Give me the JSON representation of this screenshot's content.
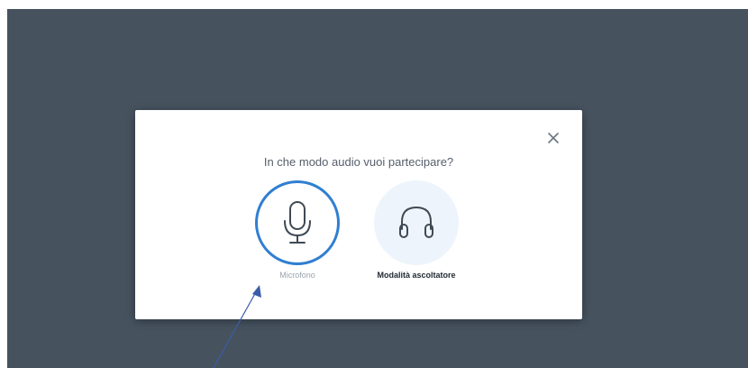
{
  "colors": {
    "backdrop": "#46525e",
    "accent": "#2f7fd1",
    "option_bg": "#eef4fb",
    "annotation_arrow": "#3b5ca8"
  },
  "modal": {
    "title": "In che modo audio vuoi partecipare?",
    "close_icon": "close-icon",
    "options": [
      {
        "label": "Microfono",
        "icon": "microphone-icon",
        "selected": true
      },
      {
        "label": "Modalità ascoltatore",
        "icon": "headphones-icon",
        "selected": false
      }
    ]
  }
}
